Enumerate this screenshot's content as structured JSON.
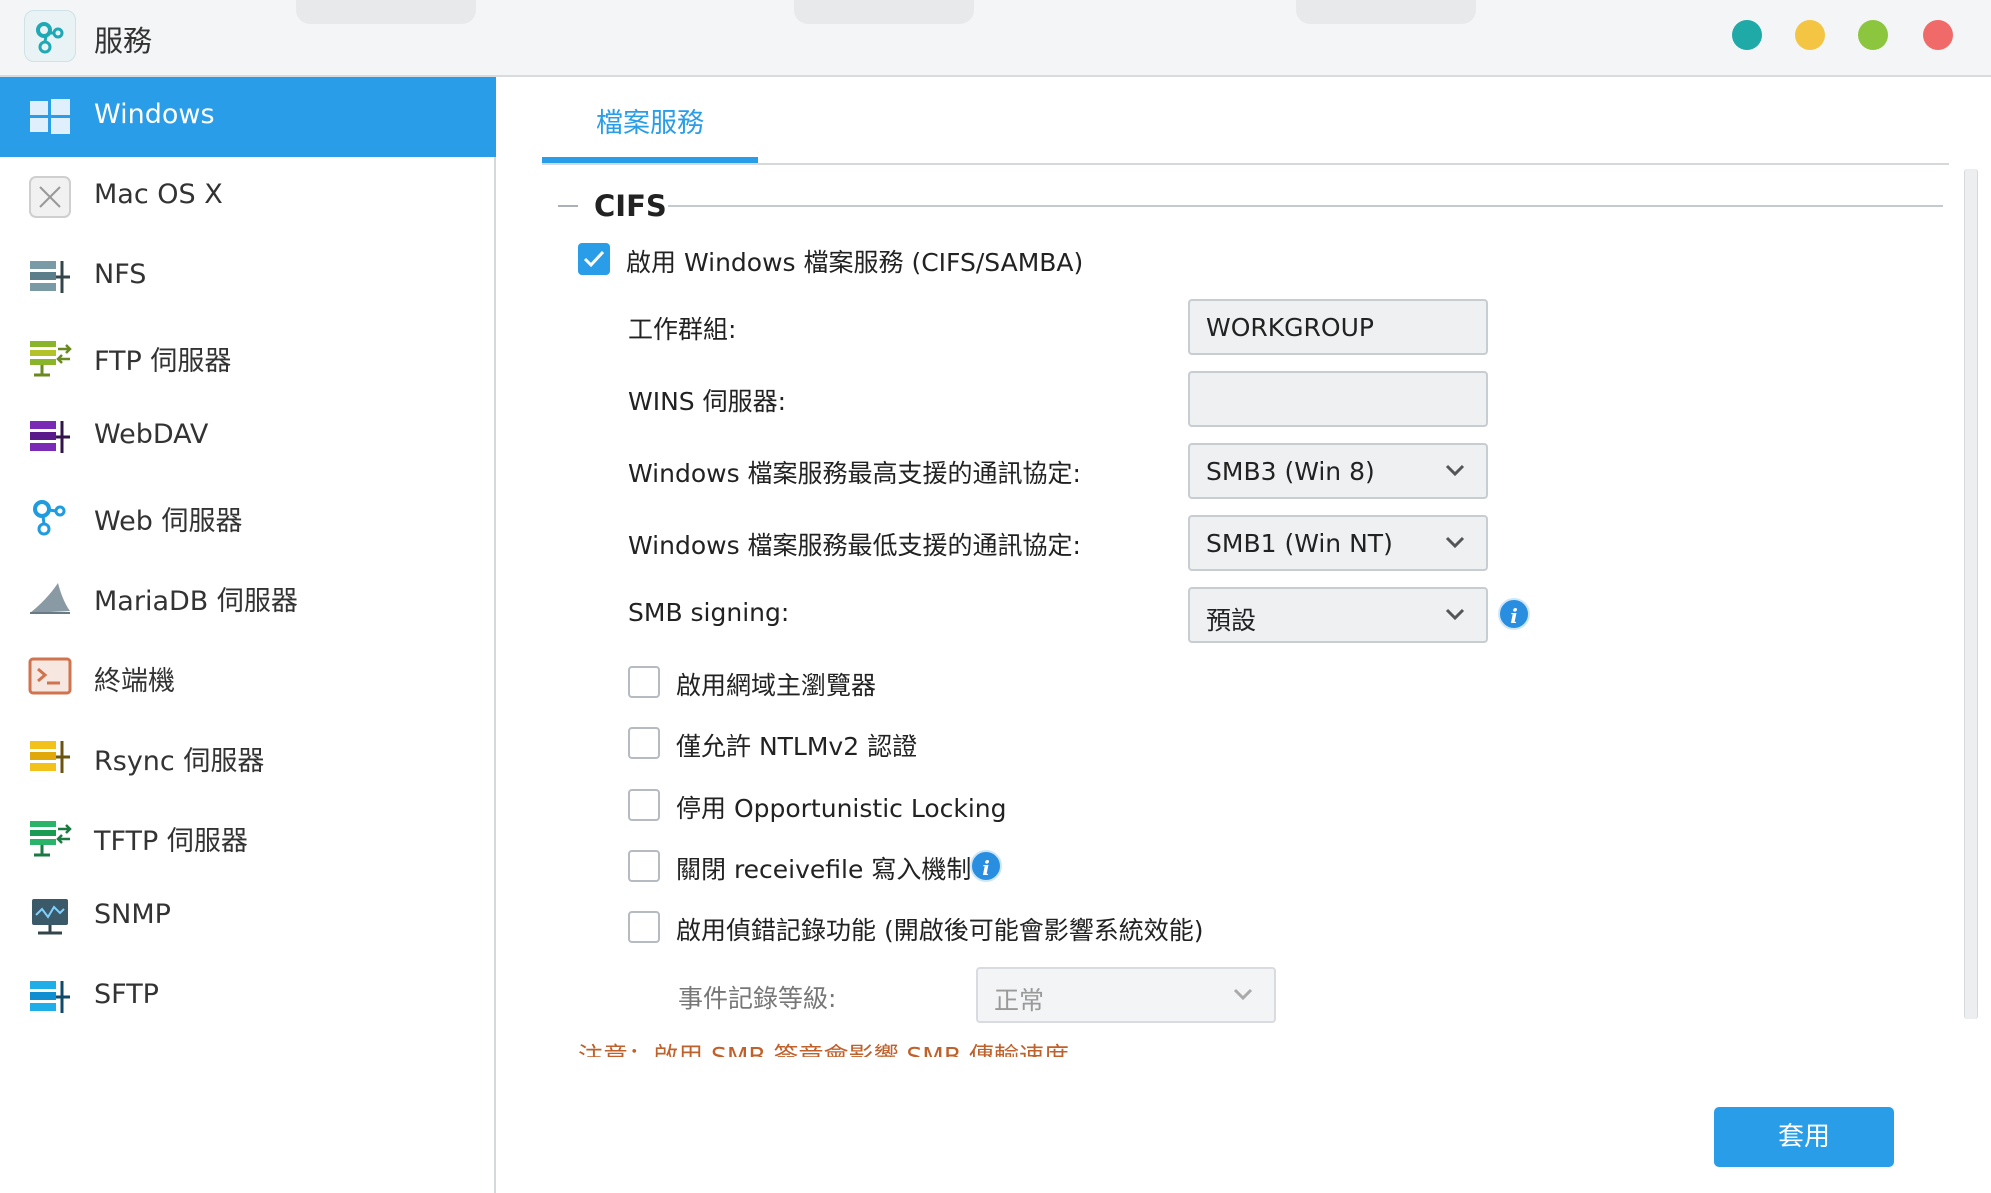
{
  "window": {
    "title": "服務",
    "buttons": [
      {
        "name": "window-button-teal",
        "color": "#1fa9a7"
      },
      {
        "name": "window-button-yellow",
        "color": "#f4c542"
      },
      {
        "name": "window-button-green",
        "color": "#8cc63f"
      },
      {
        "name": "window-button-red",
        "color": "#f06a6a"
      }
    ]
  },
  "sidebar": {
    "items": [
      {
        "label": "Windows",
        "icon": "windows-icon",
        "active": true
      },
      {
        "label": "Mac OS X",
        "icon": "mac-os-x-icon"
      },
      {
        "label": "NFS",
        "icon": "nfs-icon"
      },
      {
        "label": "FTP 伺服器",
        "icon": "ftp-server-icon"
      },
      {
        "label": "WebDAV",
        "icon": "webdav-icon"
      },
      {
        "label": "Web 伺服器",
        "icon": "web-server-icon"
      },
      {
        "label": "MariaDB 伺服器",
        "icon": "mariadb-server-icon"
      },
      {
        "label": "終端機",
        "icon": "terminal-icon"
      },
      {
        "label": "Rsync 伺服器",
        "icon": "rsync-server-icon"
      },
      {
        "label": "TFTP 伺服器",
        "icon": "tftp-server-icon"
      },
      {
        "label": "SNMP",
        "icon": "snmp-icon"
      },
      {
        "label": "SFTP",
        "icon": "sftp-icon"
      }
    ]
  },
  "main": {
    "tab": "檔案服務",
    "section_title": "CIFS",
    "enable_cifs": {
      "label": "啟用 Windows 檔案服務 (CIFS/SAMBA)",
      "checked": true
    },
    "fields": {
      "workgroup": {
        "label": "工作群組:",
        "value": "WORKGROUP"
      },
      "wins": {
        "label": "WINS 伺服器:",
        "value": ""
      },
      "max_protocol": {
        "label": "Windows 檔案服務最高支援的通訊協定:",
        "value": "SMB3 (Win 8)"
      },
      "min_protocol": {
        "label": "Windows 檔案服務最低支援的通訊協定:",
        "value": "SMB1 (Win NT)"
      },
      "smb_signing": {
        "label": "SMB signing:",
        "value": "預設"
      }
    },
    "options": [
      {
        "label": "啟用網域主瀏覽器",
        "checked": false
      },
      {
        "label": "僅允許 NTLMv2 認證",
        "checked": false
      },
      {
        "label": "停用 Opportunistic Locking",
        "checked": false
      },
      {
        "label": "關閉 receivefile 寫入機制",
        "checked": false
      },
      {
        "label": "啟用偵錯記錄功能 (開啟後可能會影響系統效能)",
        "checked": false
      }
    ],
    "log_level": {
      "label": "事件記錄等級:",
      "value": "正常"
    },
    "note": "注意：啟用 SMB 簽章會影響 SMB 傳輸速度",
    "apply_label": "套用",
    "accent_color": "#2a9de8"
  }
}
